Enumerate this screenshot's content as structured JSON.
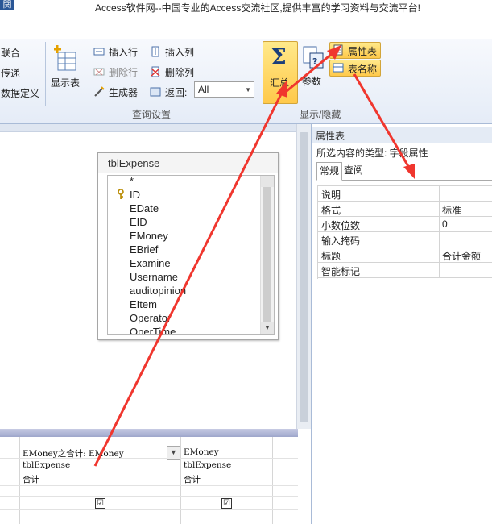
{
  "title_bar": {
    "tab_stub": "関",
    "text": "Access软件网--中国专业的Access交流社区,提供丰富的学习资料与交流平台!"
  },
  "ribbon": {
    "left_items": [
      "联合",
      "传递",
      "数据定义"
    ],
    "show_table": "显示表",
    "insert_row": "插入行",
    "delete_row": "删除行",
    "builder": "生成器",
    "insert_col": "插入列",
    "delete_col": "删除列",
    "return_label": "返回:",
    "return_value": "All",
    "totals": "汇总",
    "params": "参数",
    "property_sheet": "属性表",
    "table_names": "表名称",
    "group_query_setup": "查询设置",
    "group_show_hide": "显示/隐藏"
  },
  "table": {
    "name": "tblExpense",
    "fields": [
      "*",
      "ID",
      "EDate",
      "EID",
      "EMoney",
      "EBrief",
      "Examine",
      "Username",
      "auditopinion",
      "EItem",
      "Operator",
      "OperTime"
    ]
  },
  "grid": {
    "columns": [
      {
        "field": "EMoney之合计: EMoney",
        "table": "tblExpense",
        "total": "合计",
        "show": "☑"
      },
      {
        "field": "EMoney",
        "table": "tblExpense",
        "total": "合计",
        "show": "☑"
      }
    ]
  },
  "property_sheet": {
    "header": "属性表",
    "selection_type": "所选内容的类型: 字段属性",
    "tabs": [
      "常规",
      "查阅"
    ],
    "rows": [
      {
        "key": "说明",
        "value": ""
      },
      {
        "key": "格式",
        "value": "标准"
      },
      {
        "key": "小数位数",
        "value": "0"
      },
      {
        "key": "输入掩码",
        "value": ""
      },
      {
        "key": "标题",
        "value": "合计金额"
      },
      {
        "key": "智能标记",
        "value": ""
      }
    ]
  },
  "colors": {
    "arrow": "#f0362e",
    "highlight": "#ffd24a",
    "accent": "#2b5797"
  }
}
